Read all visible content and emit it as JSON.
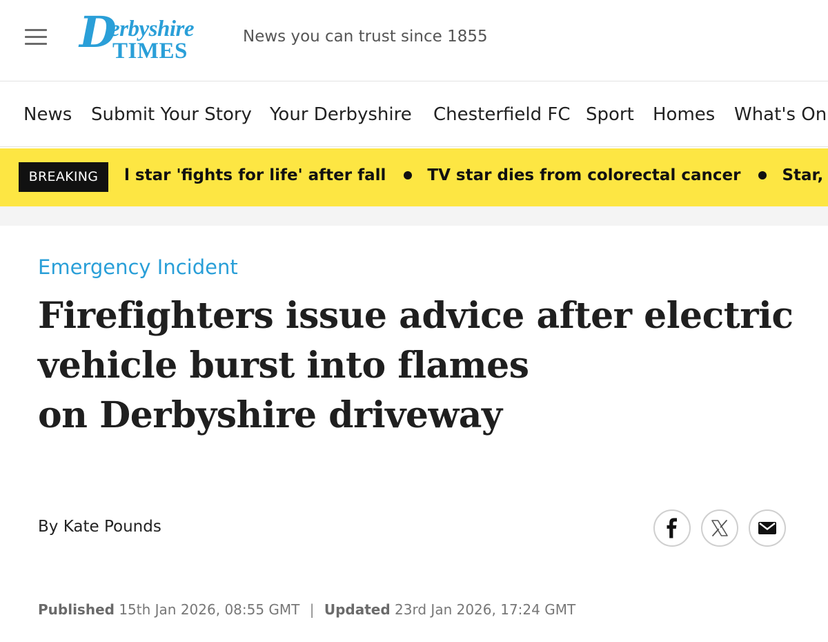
{
  "header": {
    "menu_icon": "hamburger-menu-icon",
    "logo_line1_initial": "D",
    "logo_line1_rest": "erbyshire",
    "logo_line2": "TIMES",
    "tagline": "News you can trust since 1855",
    "brand_color": "#2a9fd8"
  },
  "nav": {
    "items": [
      "News",
      "Submit Your Story",
      "Your Derbyshire",
      "Chesterfield FC",
      "Sport",
      "Homes",
      "What's On"
    ]
  },
  "breaking": {
    "label": "BREAKING",
    "items": [
      "l star 'fights for life' after fall",
      "TV star dies from colorectal cancer",
      "Star, 26, found d"
    ],
    "background_color": "#fde643"
  },
  "article": {
    "category": "Emergency Incident",
    "headline_lines": [
      "Firefighters issue advice after electric",
      "vehicle burst into flames",
      "on Derbyshire driveway"
    ],
    "byline_prefix": "By",
    "author": "Kate Pounds",
    "published_label": "Published",
    "published_date": "15th Jan 2026, 08:55 GMT",
    "separator": "|",
    "updated_label": "Updated",
    "updated_date": "23rd Jan 2026, 17:24 GMT"
  },
  "share": {
    "icons": [
      "facebook-icon",
      "x-icon",
      "email-icon"
    ]
  }
}
